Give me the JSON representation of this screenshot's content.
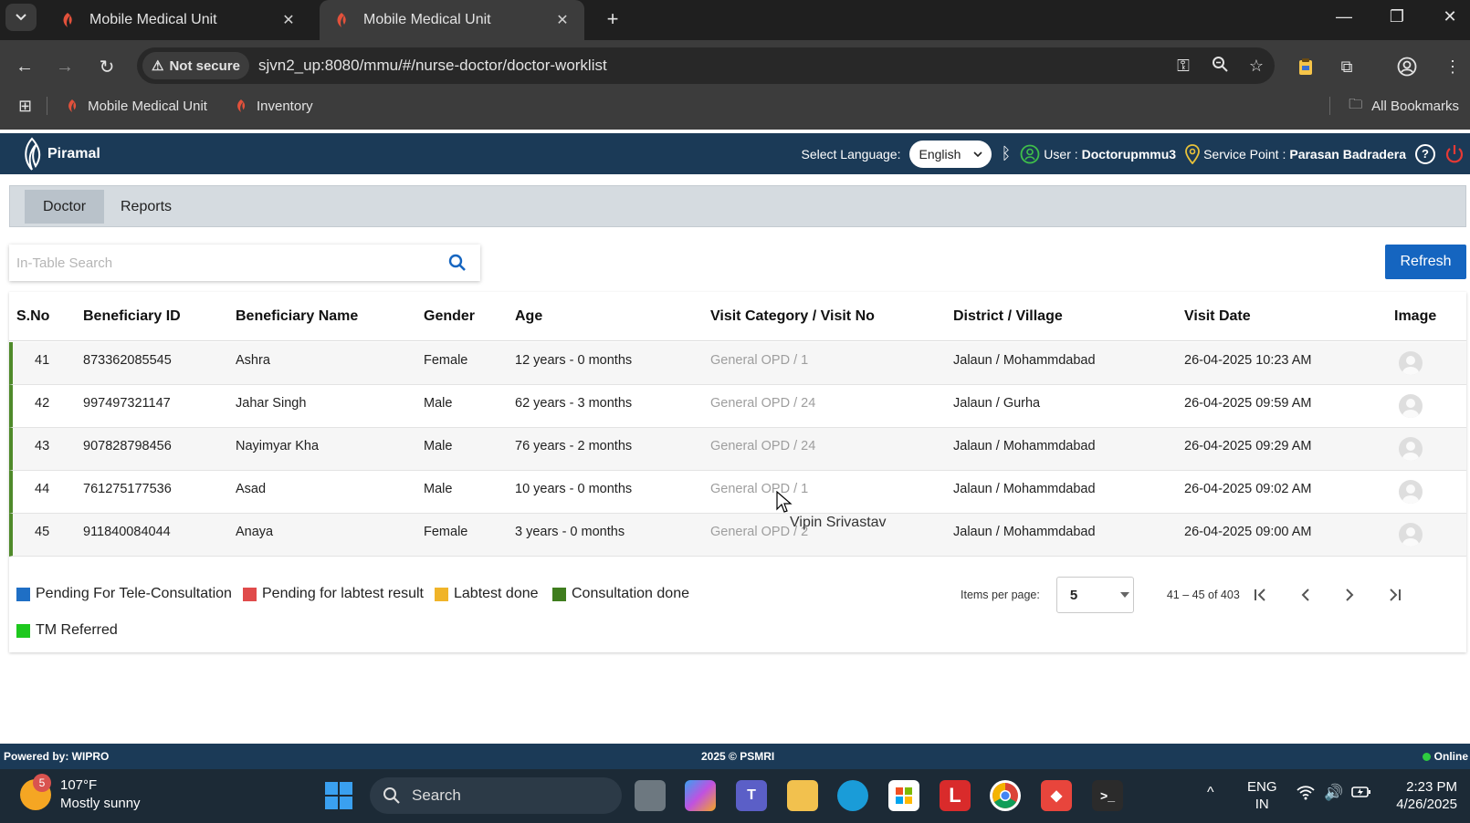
{
  "browser": {
    "tabs": [
      {
        "title": "Mobile Medical Unit",
        "active": false
      },
      {
        "title": "Mobile Medical Unit",
        "active": true
      }
    ],
    "not_secure": "Not secure",
    "url": "sjvn2_up:8080/mmu/#/nurse-doctor/doctor-worklist",
    "bookmarks": [
      "Mobile Medical Unit",
      "Inventory"
    ],
    "all_bookmarks": "All Bookmarks"
  },
  "header": {
    "logo": "Piramal",
    "select_language_label": "Select Language:",
    "language": "English",
    "user_label": "User :",
    "user": "Doctorupmmu3",
    "service_point_label": "Service Point :",
    "service_point": "Parasan Badradera"
  },
  "app_tabs": [
    "Doctor",
    "Reports"
  ],
  "search": {
    "placeholder": "In-Table Search"
  },
  "refresh_label": "Refresh",
  "table": {
    "columns": [
      "S.No",
      "Beneficiary ID",
      "Beneficiary Name",
      "Gender",
      "Age",
      "Visit Category / Visit No",
      "District / Village",
      "Visit Date",
      "Image"
    ],
    "rows": [
      {
        "sno": "41",
        "id": "873362085545",
        "name": "Ashra",
        "gender": "Female",
        "age": "12 years - 0 months",
        "visit_cat": "General OPD",
        "visit_no": "1",
        "district": "Jalaun / Mohammdabad",
        "date": "26-04-2025 10:23 AM"
      },
      {
        "sno": "42",
        "id": "997497321147",
        "name": "Jahar Singh",
        "gender": "Male",
        "age": "62 years - 3 months",
        "visit_cat": "General OPD",
        "visit_no": "24",
        "district": "Jalaun / Gurha",
        "date": "26-04-2025 09:59 AM"
      },
      {
        "sno": "43",
        "id": "907828798456",
        "name": "Nayimyar Kha",
        "gender": "Male",
        "age": "76 years - 2 months",
        "visit_cat": "General OPD",
        "visit_no": "24",
        "district": "Jalaun / Mohammdabad",
        "date": "26-04-2025 09:29 AM"
      },
      {
        "sno": "44",
        "id": "761275177536",
        "name": "Asad",
        "gender": "Male",
        "age": "10 years - 0 months",
        "visit_cat": "General OPD",
        "visit_no": "1",
        "district": "Jalaun / Mohammdabad",
        "date": "26-04-2025 09:02 AM"
      },
      {
        "sno": "45",
        "id": "911840084044",
        "name": "Anaya",
        "gender": "Female",
        "age": "3 years - 0 months",
        "visit_cat": "General OPD",
        "visit_no": "2",
        "district": "Jalaun / Mohammdabad",
        "date": "26-04-2025 09:00 AM"
      }
    ]
  },
  "tooltip": "Vipin Srivastav",
  "legend": [
    {
      "label": "Pending For Tele-Consultation",
      "color": "#1f6fc5"
    },
    {
      "label": "Pending for labtest result",
      "color": "#e04b4b"
    },
    {
      "label": "Labtest done",
      "color": "#f0b429"
    },
    {
      "label": "Consultation done",
      "color": "#3f7d1e"
    },
    {
      "label": "TM Referred",
      "color": "#1ec81e"
    }
  ],
  "paginator": {
    "items_per_page_label": "Items per page:",
    "items_per_page": "5",
    "range": "41 – 45 of 403"
  },
  "footer": {
    "left": "Powered by: WIPRO",
    "center": "2025 © PSMRI",
    "right": "Online"
  },
  "taskbar": {
    "temperature": "107°F",
    "weather": "Mostly sunny",
    "weather_badge": "5",
    "search": "Search",
    "lang_top": "ENG",
    "lang_bottom": "IN",
    "time": "2:23 PM",
    "date": "4/26/2025"
  }
}
